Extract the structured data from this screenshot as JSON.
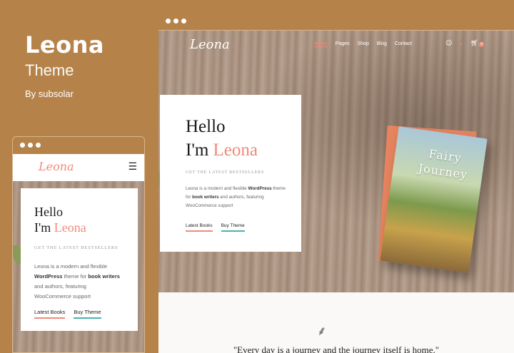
{
  "brand": {
    "title": "Leona",
    "subtitle": "Theme",
    "author": "By subsolar"
  },
  "desktop": {
    "logo": "Leona",
    "nav": [
      "Home",
      "Pages",
      "Shop",
      "Blog",
      "Contact"
    ],
    "cart_count": "0",
    "hero": {
      "hello": "Hello",
      "im": "I'm ",
      "name": "Leona",
      "tagline": "GET THE LATEST BESTSELLERS",
      "para_1": "Leona is a modern and flexible ",
      "para_bold_1": "WordPress",
      "para_2": " theme for ",
      "para_bold_2": "book writers",
      "para_3": " and authors, featuring WooCommerce support",
      "btn_primary": "Latest Books",
      "btn_secondary": "Buy Theme"
    },
    "book_title": "Fairy Journey",
    "quote": "\"Every day is a journey and the journey itself is home.\""
  },
  "mobile": {
    "logo": "Leona",
    "hero": {
      "hello": "Hello",
      "im": "I'm ",
      "name": "Leona",
      "tagline": "GET THE LATEST BESTSELLERS",
      "para_1": "Leona is a modern and flexible ",
      "para_bold_1": "WordPress",
      "para_2": " theme for ",
      "para_bold_2": "book writers",
      "para_3": " and authors, featuring WooCommerce support",
      "btn_primary": "Latest Books",
      "btn_secondary": "Buy Theme"
    }
  },
  "colors": {
    "background": "#b5834a",
    "accent": "#f08a7a",
    "teal": "#4ab3b0"
  }
}
